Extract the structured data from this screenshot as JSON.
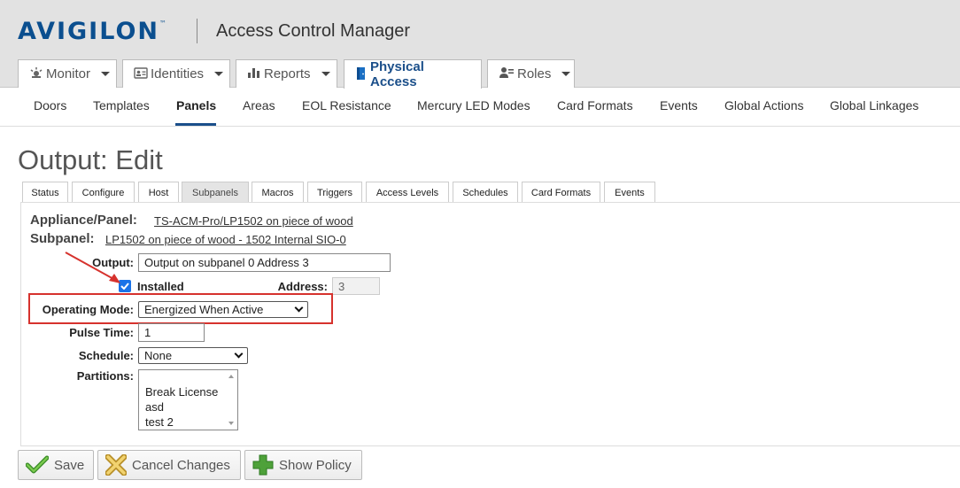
{
  "header": {
    "logo_text": "AVIGILON",
    "logo_tm": "™",
    "app_title": "Access Control Manager",
    "main_tabs": [
      {
        "label": "Monitor",
        "icon": "monitor-icon"
      },
      {
        "label": "Identities",
        "icon": "id-card-icon"
      },
      {
        "label": "Reports",
        "icon": "bar-chart-icon"
      },
      {
        "label": "Physical Access",
        "icon": "door-icon",
        "active": true
      },
      {
        "label": "Roles",
        "icon": "roles-icon"
      }
    ]
  },
  "subnav": [
    "Doors",
    "Templates",
    "Panels",
    "Areas",
    "EOL Resistance",
    "Mercury LED Modes",
    "Card Formats",
    "Events",
    "Global Actions",
    "Global Linkages"
  ],
  "subnav_active": "Panels",
  "page_title": "Output: Edit",
  "page_tabs": [
    "Status",
    "Configure",
    "Host",
    "Subpanels",
    "Macros",
    "Triggers",
    "Access Levels",
    "Schedules",
    "Card Formats",
    "Events"
  ],
  "page_tab_active": "Subpanels",
  "form": {
    "appliance_label": "Appliance/Panel:",
    "appliance_value": "TS-ACM-Pro/LP1502 on piece of wood",
    "subpanel_label": "Subpanel:",
    "subpanel_value": "LP1502 on piece of wood - 1502 Internal SIO-0",
    "output_label": "Output:",
    "output_value": "Output on subpanel 0 Address 3",
    "installed_label": "Installed",
    "installed_checked": true,
    "address_label": "Address:",
    "address_value": "3",
    "operating_mode_label": "Operating Mode:",
    "operating_mode_value": "Energized When Active",
    "pulse_time_label": "Pulse Time:",
    "pulse_time_value": "1",
    "schedule_label": "Schedule:",
    "schedule_value": "None",
    "partitions_label": "Partitions:",
    "partitions": [
      "Break License",
      "asd",
      "test 2"
    ]
  },
  "buttons": {
    "save": "Save",
    "cancel": "Cancel Changes",
    "show_policy": "Show Policy"
  },
  "colors": {
    "brand": "#0b4f8f",
    "highlight_box": "#d6322d",
    "annotation_arrow": "#d6322d",
    "checkbox": "#1a73e8"
  }
}
